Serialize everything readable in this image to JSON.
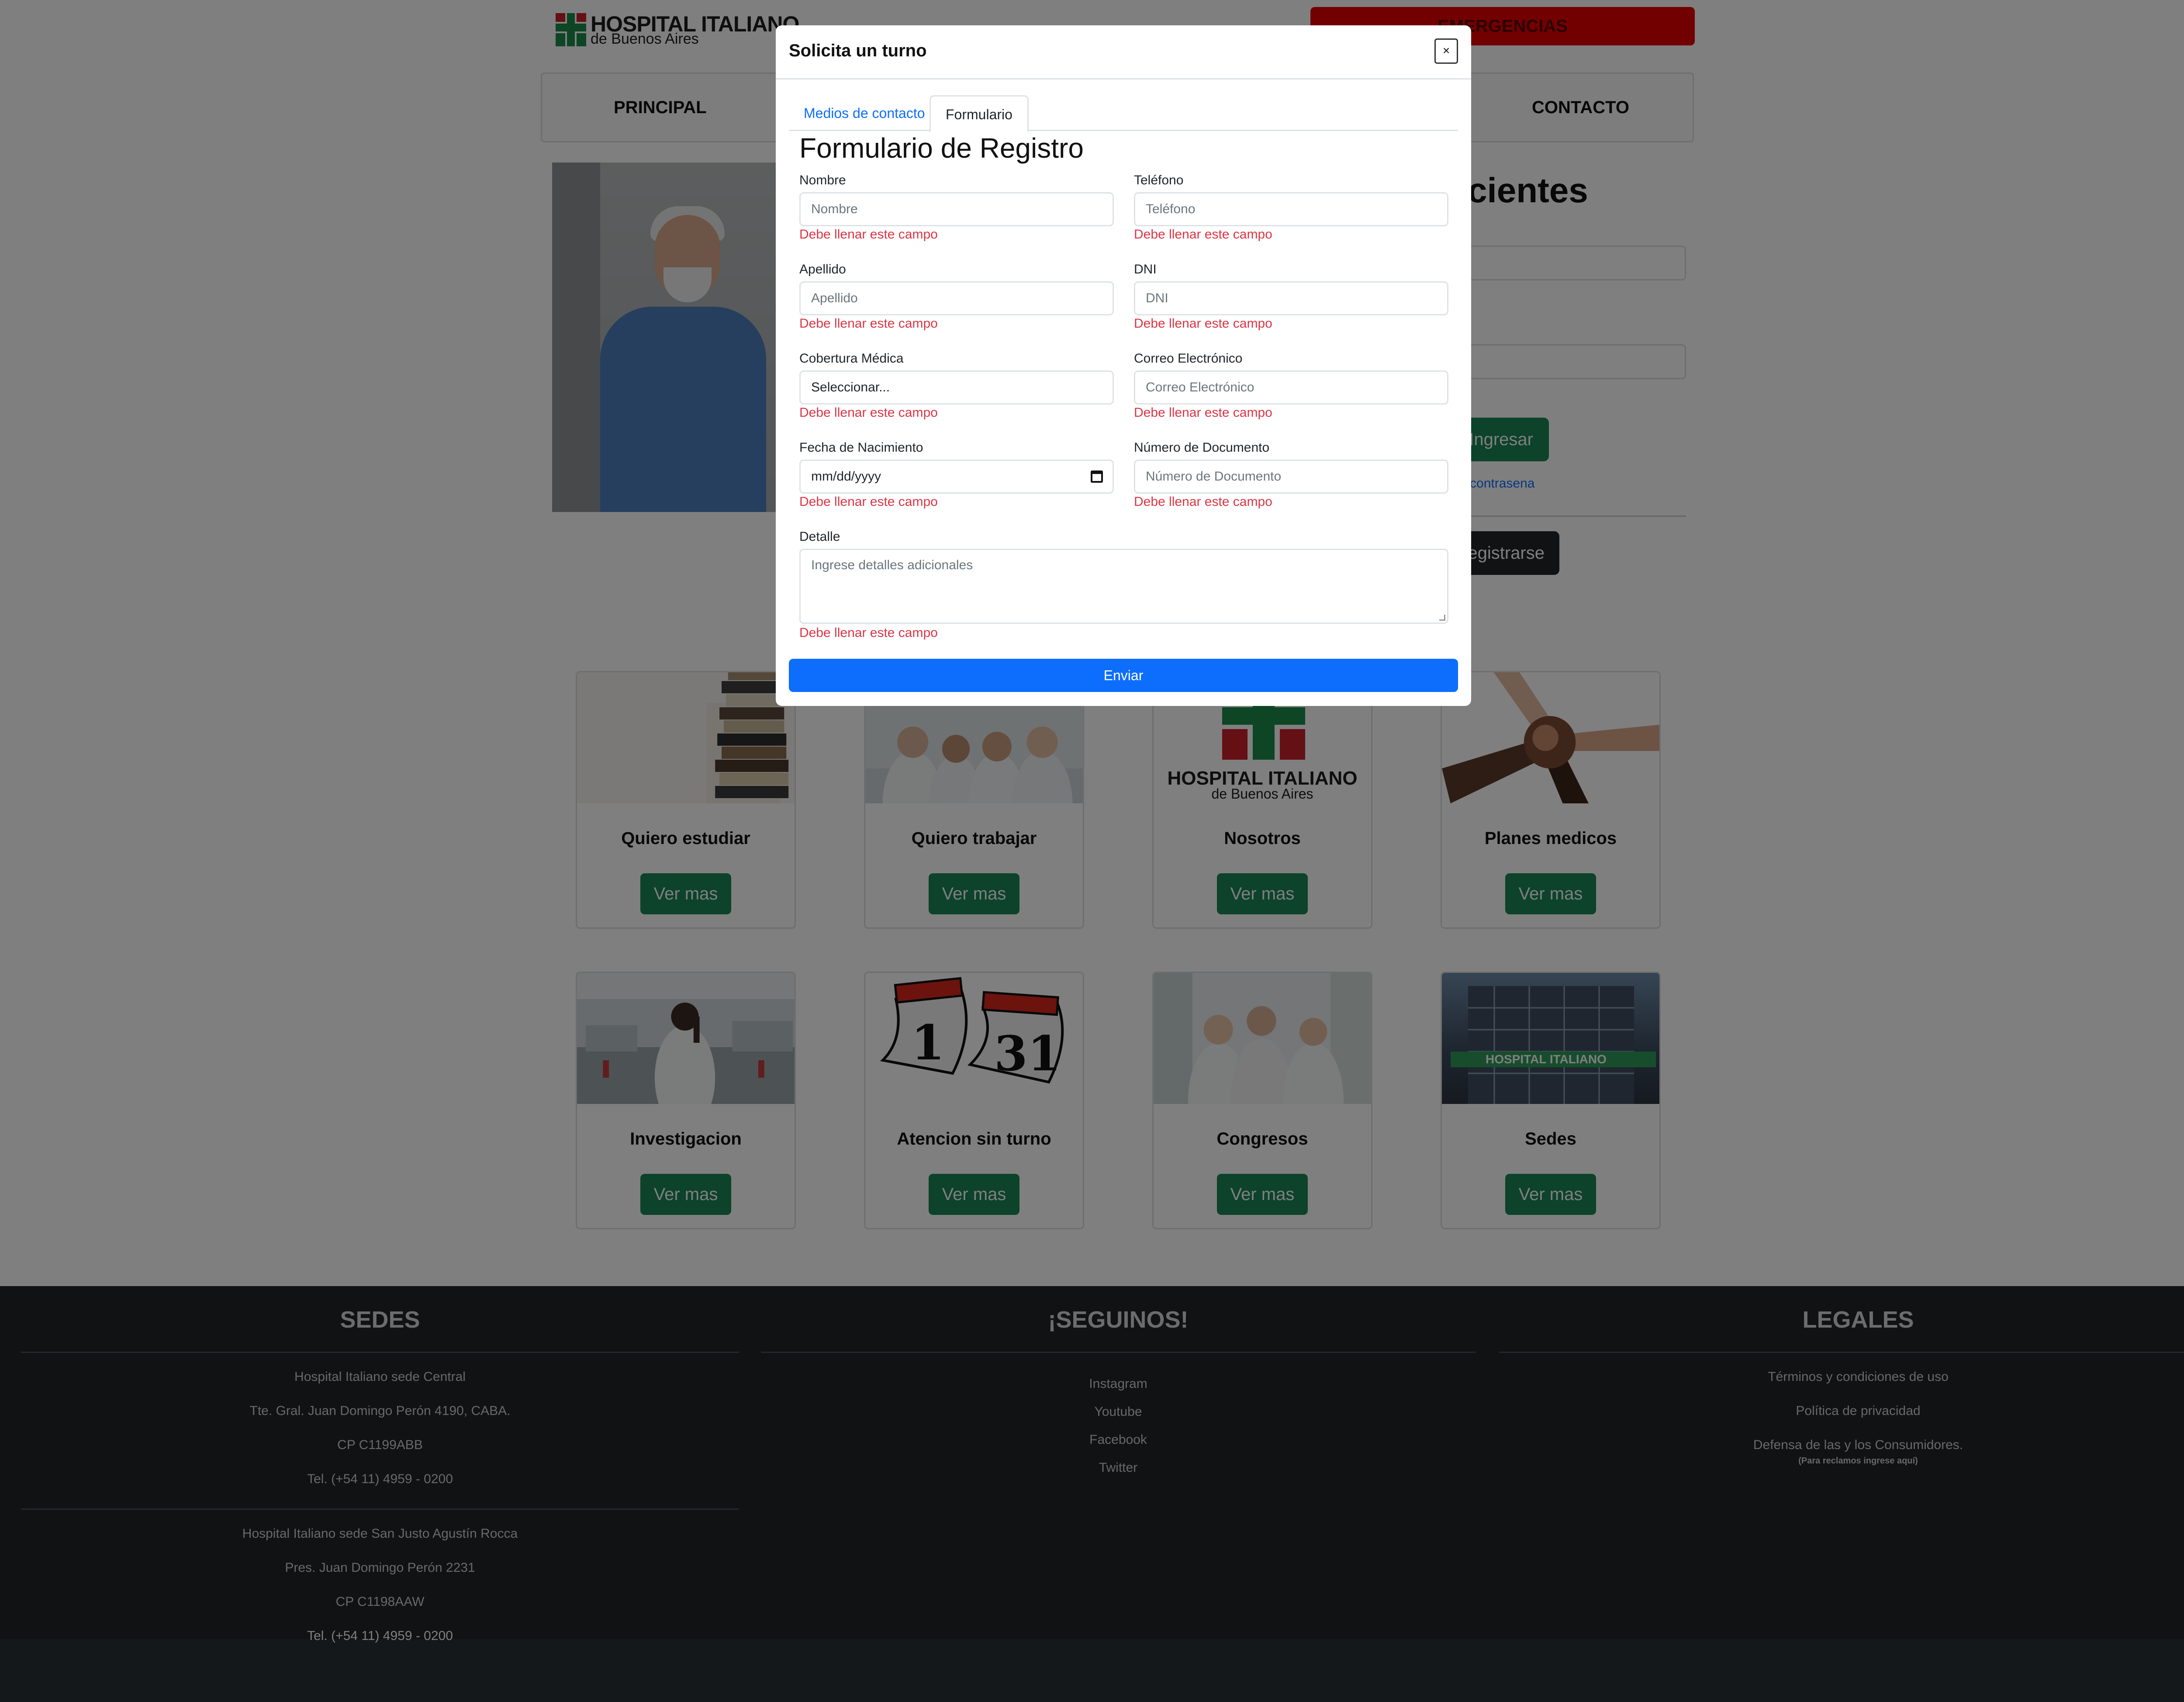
{
  "header": {
    "logo_title": "HOSPITAL ITALIANO",
    "logo_subtitle": "de Buenos Aires",
    "emergency_label": "EMERGENCIAS"
  },
  "nav": {
    "items": [
      "PRINCIPAL",
      "CONTACTO"
    ]
  },
  "login": {
    "title_partial": "cientes",
    "submit_label": "Ingresar",
    "forgot_label": "e mi contrasena",
    "register_label": "egistrarse"
  },
  "cards": [
    {
      "title": "Quiero estudiar",
      "button": "Ver mas",
      "icon": "books-image"
    },
    {
      "title": "Quiero trabajar",
      "button": "Ver mas",
      "icon": "doctors-image"
    },
    {
      "title": "Nosotros",
      "button": "Ver mas",
      "icon": "hospital-logo-image",
      "logo_title": "HOSPITAL ITALIANO",
      "logo_subtitle": "de Buenos Aires"
    },
    {
      "title": "Planes medicos",
      "button": "Ver mas",
      "icon": "hands-image"
    },
    {
      "title": "Investigacion",
      "button": "Ver mas",
      "icon": "lab-image"
    },
    {
      "title": "Atencion sin turno",
      "button": "Ver mas",
      "icon": "calendar-image",
      "calendar_day1": "1",
      "calendar_day2": "31"
    },
    {
      "title": "Congresos",
      "button": "Ver mas",
      "icon": "congress-image"
    },
    {
      "title": "Sedes",
      "button": "Ver mas",
      "icon": "building-image",
      "sign_text": "HOSPITAL ITALIANO"
    }
  ],
  "footer": {
    "sedes": {
      "title": "SEDES",
      "lines": [
        "Hospital Italiano sede Central",
        "Tte. Gral. Juan Domingo Perón 4190, CABA.",
        "CP C1199ABB",
        "Tel. (+54 11) 4959 - 0200",
        "Hospital Italiano sede San Justo Agustín Rocca",
        "Pres. Juan Domingo Perón 2231",
        "CP C1198AAW",
        "Tel. (+54 11) 4959 - 0200"
      ]
    },
    "seguinos": {
      "title": "¡SEGUINOS!",
      "links": [
        "Instagram",
        "Youtube",
        "Facebook",
        "Twitter"
      ]
    },
    "legales": {
      "title": "LEGALES",
      "links": [
        "Términos y condiciones de uso",
        "Política de privacidad",
        "Defensa de las y los Consumidores."
      ],
      "note": "(Para reclamos ingrese aquí)"
    }
  },
  "modal": {
    "title": "Solicita un turno",
    "close_label": "×",
    "tabs": [
      "Medios de contacto",
      "Formulario"
    ],
    "form_title": "Formulario de Registro",
    "fields": {
      "nombre": {
        "label": "Nombre",
        "placeholder": "Nombre"
      },
      "telefono": {
        "label": "Teléfono",
        "placeholder": "Teléfono"
      },
      "apellido": {
        "label": "Apellido",
        "placeholder": "Apellido"
      },
      "dni": {
        "label": "DNI",
        "placeholder": "DNI"
      },
      "cobertura": {
        "label": "Cobertura Médica",
        "value": "Seleccionar..."
      },
      "correo": {
        "label": "Correo Electrónico",
        "placeholder": "Correo Electrónico"
      },
      "nacimiento": {
        "label": "Fecha de Nacimiento",
        "value": "mm/dd/yyyy"
      },
      "documento": {
        "label": "Número de Documento",
        "placeholder": "Número de Documento"
      },
      "detalle": {
        "label": "Detalle",
        "placeholder": "Ingrese detalles adicionales"
      }
    },
    "error_text": "Debe llenar este campo",
    "submit_label": "Enviar"
  },
  "colors": {
    "primary": "#0d6efd",
    "success": "#198754",
    "danger": "#dc3545",
    "emergency": "#e60000",
    "footer_bg": "#212529",
    "logo_green": "#1a8a4a",
    "logo_red": "#c8202a"
  }
}
